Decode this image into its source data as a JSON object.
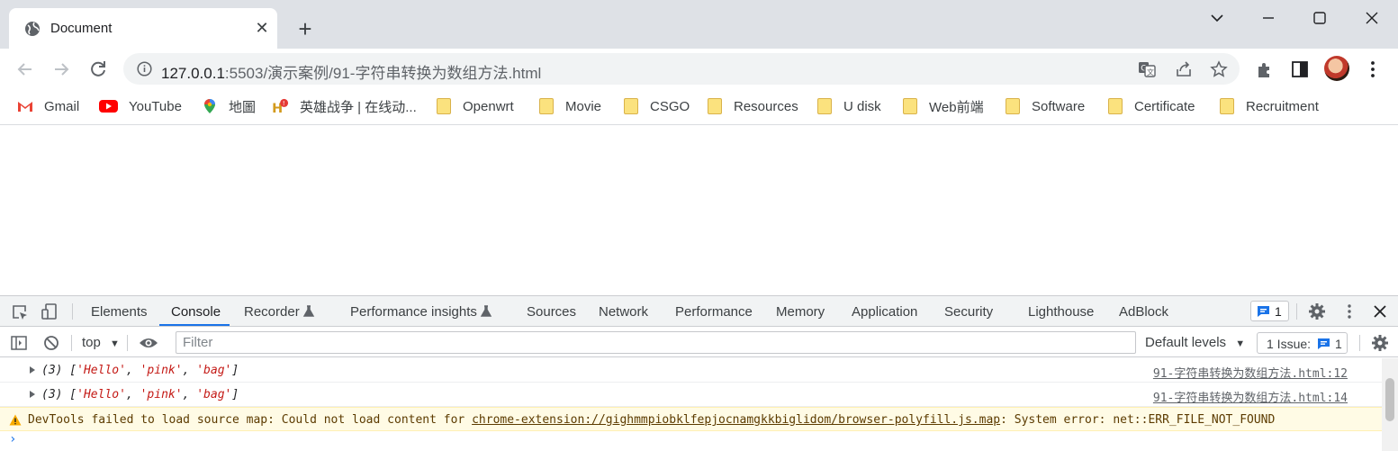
{
  "browser": {
    "tab": {
      "title": "Document"
    },
    "new_tab_label": "+",
    "url": {
      "host": "127.0.0.1",
      "rest": ":5503/演示案例/91-字符串转换为数组方法.html"
    }
  },
  "bookmarks": [
    {
      "label": "Gmail",
      "icon": "gmail-icon"
    },
    {
      "label": "YouTube",
      "icon": "youtube-icon"
    },
    {
      "label": "地圖",
      "icon": "maps-icon"
    },
    {
      "label": "英雄战争 | 在线动...",
      "icon": "game-icon"
    },
    {
      "label": "Openwrt",
      "icon": "folder-icon"
    },
    {
      "label": "Movie",
      "icon": "folder-icon"
    },
    {
      "label": "CSGO",
      "icon": "folder-icon"
    },
    {
      "label": "Resources",
      "icon": "folder-icon"
    },
    {
      "label": "U disk",
      "icon": "folder-icon"
    },
    {
      "label": "Web前端",
      "icon": "folder-icon"
    },
    {
      "label": "Software",
      "icon": "folder-icon"
    },
    {
      "label": "Certificate",
      "icon": "folder-icon"
    },
    {
      "label": "Recruitment",
      "icon": "folder-icon"
    }
  ],
  "devtools": {
    "tabs": [
      "Elements",
      "Console",
      "Recorder",
      "Performance insights",
      "Sources",
      "Network",
      "Performance",
      "Memory",
      "Application",
      "Security",
      "Lighthouse",
      "AdBlock"
    ],
    "active_tab": "Console",
    "message_badge": "1",
    "context": "top",
    "filter_placeholder": "Filter",
    "levels": "Default levels",
    "issues": {
      "label": "1 Issue:",
      "count": "1"
    },
    "console": [
      {
        "prefix": "(3) [",
        "items": [
          "'Hello'",
          "'pink'",
          "'bag'"
        ],
        "suffix": "]",
        "source": "91-字符串转换为数组方法.html:12"
      },
      {
        "prefix": "(3) [",
        "items": [
          "'Hello'",
          "'pink'",
          "'bag'"
        ],
        "suffix": "]",
        "source": "91-字符串转换为数组方法.html:14"
      }
    ],
    "warning": {
      "before": "DevTools failed to load source map: Could not load content for ",
      "link": "chrome-extension://gighmmpiobklfepjocnamgkkbiglidom/browser-polyfill.js.map",
      "after": ": System error: net::ERR_FILE_NOT_FOUND"
    },
    "prompt": "›"
  },
  "colors": {
    "accent": "#1a73e8",
    "string": "#c41a16",
    "warning_bg": "#fffbe5"
  }
}
